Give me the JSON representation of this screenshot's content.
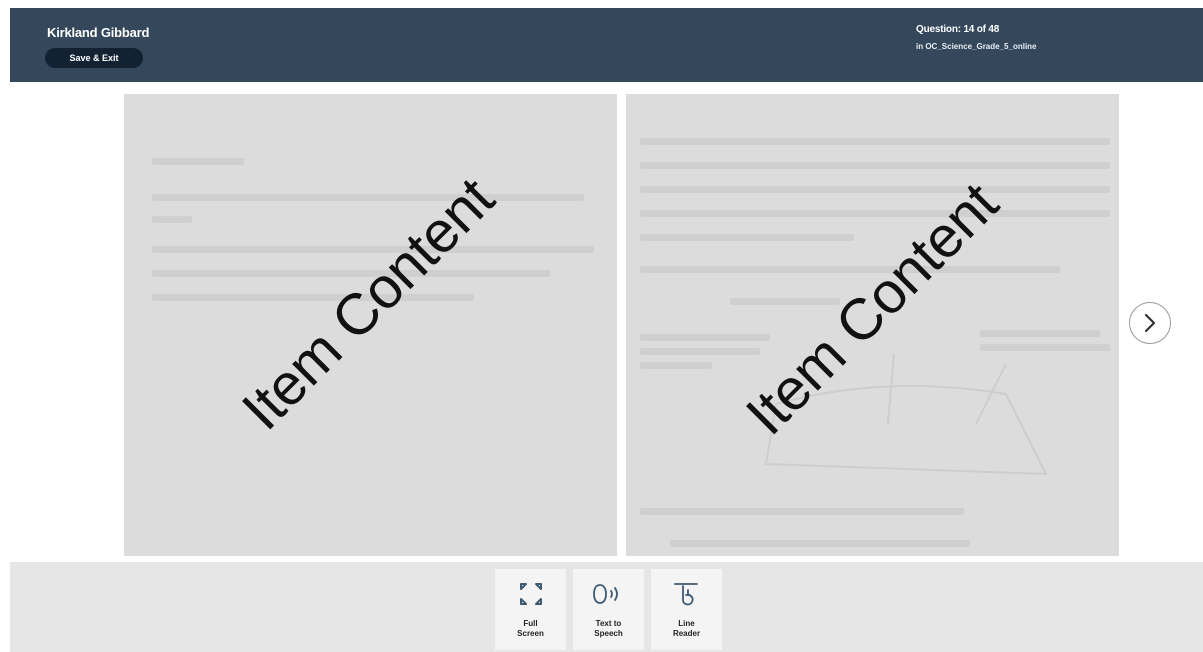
{
  "header": {
    "student_name": "Kirkland Gibbard",
    "save_exit_label": "Save & Exit",
    "question_counter": "Question: 14 of 48",
    "test_name": "in OC_Science_Grade_5_online"
  },
  "content": {
    "left_panel": {
      "watermark": "Item Content"
    },
    "right_panel": {
      "watermark": "Item Content"
    },
    "next_icon": "chevron-right-icon"
  },
  "toolbar": {
    "tools": [
      {
        "line1": "Full",
        "line2": "Screen",
        "icon": "full-screen-icon"
      },
      {
        "line1": "Text to",
        "line2": "Speech",
        "icon": "text-to-speech-icon"
      },
      {
        "line1": "Line",
        "line2": "Reader",
        "icon": "line-reader-icon"
      }
    ]
  },
  "colors": {
    "header_bg": "#34475b",
    "button_bg": "#132233",
    "panel_bg": "#dcdcdc",
    "toolbar_bg": "#e6e6e6",
    "tool_icon": "#3d5a73"
  }
}
